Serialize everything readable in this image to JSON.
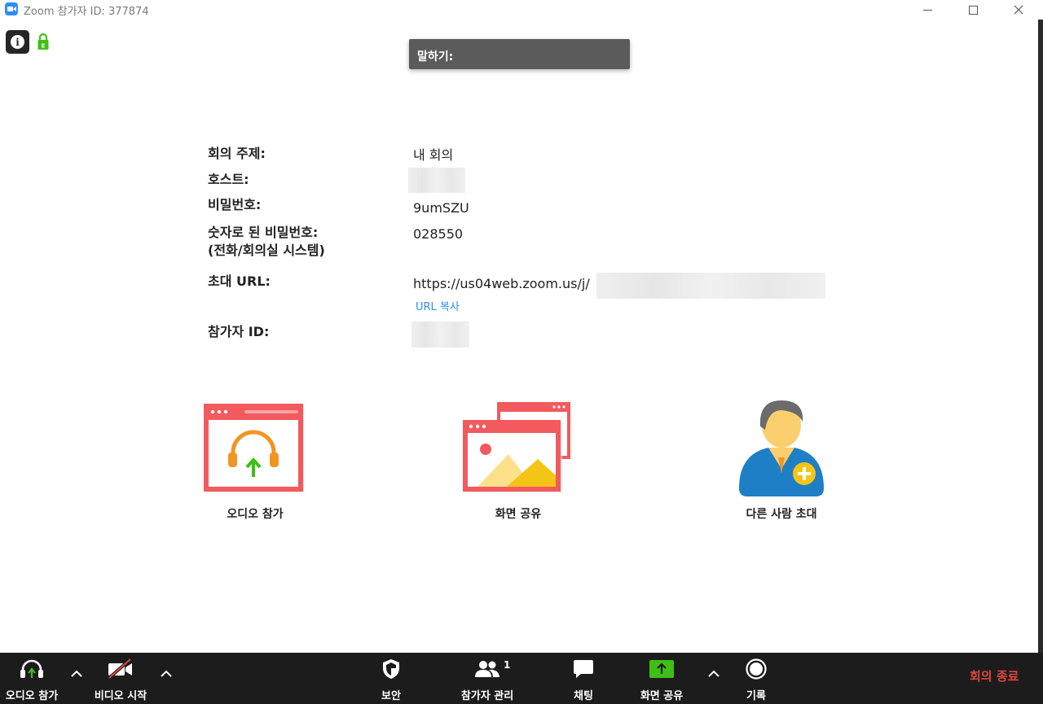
{
  "window": {
    "title": "Zoom 참가자 ID: 377874"
  },
  "speaking": {
    "label": "말하기:"
  },
  "meeting": {
    "topic_label": "회의 주제:",
    "topic_value": "내 회의",
    "host_label": "호스트:",
    "password_label": "비밀번호:",
    "password_value": "9umSZU",
    "numeric_password_label_1": "숫자로 된 비밀번호:",
    "numeric_password_label_2": "(전화/회의실 시스템)",
    "numeric_password_value": "028550",
    "invite_url_label": "초대 URL:",
    "invite_url_value": "https://us04web.zoom.us/j/",
    "copy_url": "URL 복사",
    "participant_id_label": "참가자 ID:"
  },
  "actions": {
    "join_audio": "오디오 참가",
    "share_screen": "화면 공유",
    "invite_others": "다른 사람 초대"
  },
  "toolbar": {
    "join_audio": "오디오 참가",
    "start_video": "비디오 시작",
    "security": "보안",
    "participants": "참가자 관리",
    "participant_count": "1",
    "chat": "채팅",
    "share_screen": "화면 공유",
    "record": "기록",
    "end_meeting": "회의 종료"
  },
  "colors": {
    "accent_blue": "#2d8cff",
    "tile_red": "#f25a5e",
    "share_green": "#3fbf16",
    "end_red": "#e0463c",
    "toolbar_bg": "#1c1c1c"
  }
}
